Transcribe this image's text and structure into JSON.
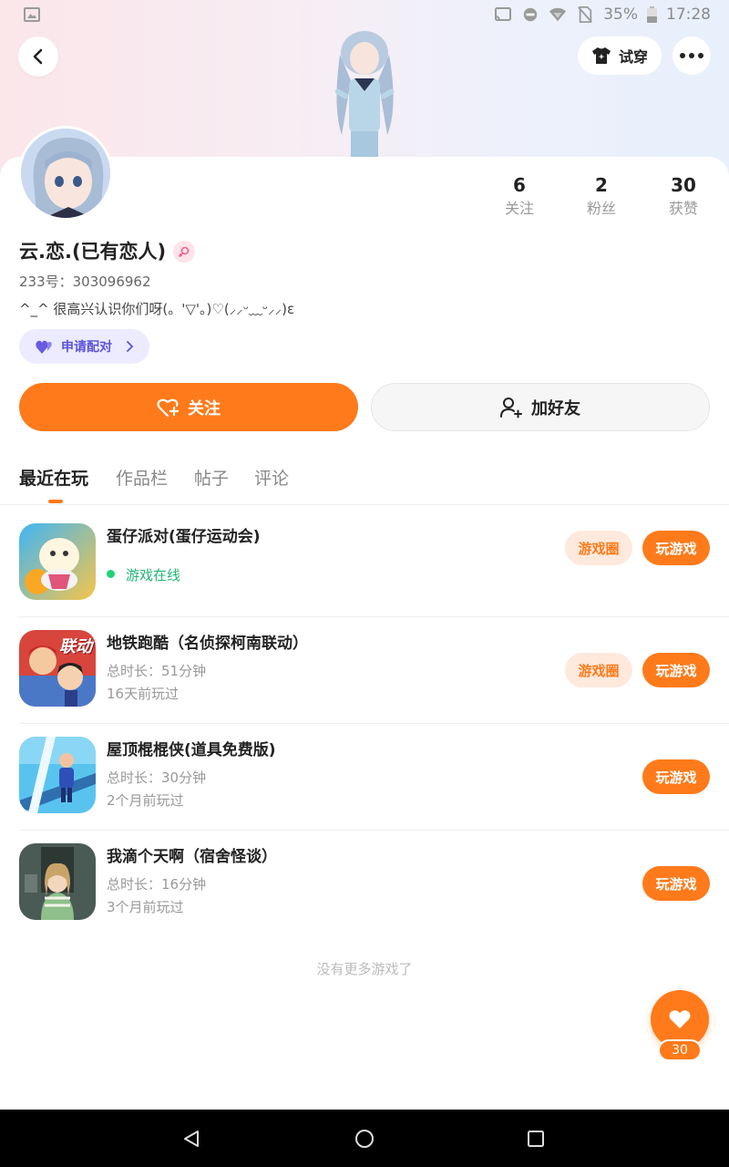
{
  "status_bar": {
    "battery": "35%",
    "time": "17:28",
    "icons": [
      "image-icon",
      "cast-icon",
      "dnd-icon",
      "wifi-icon",
      "no-sim-icon",
      "battery-icon"
    ]
  },
  "header": {
    "back_icon": "chevron-left-icon",
    "tryon_label": "试穿",
    "tryon_icon": "tshirt-icon",
    "more_icon": "more-dots-icon"
  },
  "profile": {
    "stats": [
      {
        "value": "6",
        "label": "关注"
      },
      {
        "value": "2",
        "label": "粉丝"
      },
      {
        "value": "30",
        "label": "获赞"
      }
    ],
    "username": "云.恋.(已有恋人)",
    "gender_icon": "female-icon",
    "uid": "233号：303096962",
    "bio": "^_^ 很高兴认识你们呀(。'▽'。)♡(⸝⸝ᵕ﹏ᵕ⸝⸝)ε",
    "pair_button": "申请配对",
    "follow_button": "关注",
    "add_friend_button": "加好友"
  },
  "tabs": [
    {
      "label": "最近在玩",
      "active": true
    },
    {
      "label": "作品栏",
      "active": false
    },
    {
      "label": "帖子",
      "active": false
    },
    {
      "label": "评论",
      "active": false
    }
  ],
  "games": [
    {
      "title": "蛋仔派对(蛋仔运动会)",
      "line1": "游戏在线",
      "line2": "",
      "online": true,
      "circle_label": "游戏圈",
      "play_label": "玩游戏"
    },
    {
      "title": "地铁跑酷（名侦探柯南联动）",
      "line1": "总时长：51分钟",
      "line2": "16天前玩过",
      "online": false,
      "circle_label": "游戏圈",
      "play_label": "玩游戏"
    },
    {
      "title": "屋顶棍棍侠(道具免费版)",
      "line1": "总时长：30分钟",
      "line2": "2个月前玩过",
      "online": false,
      "circle_label": "",
      "play_label": "玩游戏"
    },
    {
      "title": "我滴个天啊（宿舍怪谈）",
      "line1": "总时长：16分钟",
      "line2": "3个月前玩过",
      "online": false,
      "circle_label": "",
      "play_label": "玩游戏"
    }
  ],
  "subway_badge": "联动",
  "no_more": "没有更多游戏了",
  "like_fab": {
    "count": "30",
    "icon": "heart-icon"
  },
  "colors": {
    "accent": "#ff7a1a",
    "online": "#22b573",
    "pair": "#5a55d8"
  }
}
